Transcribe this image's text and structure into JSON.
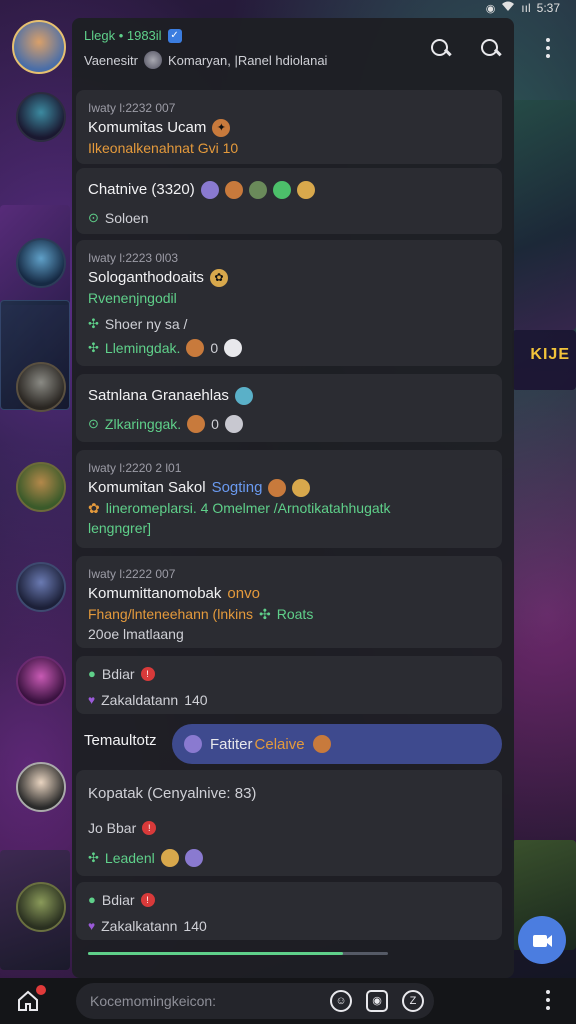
{
  "status_bar": {
    "time": "5:37",
    "signal": "ııl",
    "wifi": "wifi",
    "icon": "◉"
  },
  "header": {
    "title": "Llegk • 1983il",
    "subtitle_prefix": "Vaenesitr",
    "subtitle": "Komaryan, |Ranel hdiolanai"
  },
  "messages": [
    {
      "meta": "Iwaty l:2232 007",
      "title": "Komumitas Ucam",
      "sub": "Ilkeonalkenahnat Gvi 10"
    },
    {
      "title": "Chatnive (3320)",
      "status": "Soloen"
    },
    {
      "meta": "Iwaty l:2223 0l03",
      "title": "Sologanthodoaits",
      "sub": "Rvenenjngodil",
      "line3": "Shoer ny sa /",
      "line4": "Llemingdak.",
      "count": "0"
    },
    {
      "title": "Satnlana Granaehlas",
      "line2": "Zlkaringgak.",
      "count": "0"
    },
    {
      "meta": "Iwaty l:2220 2 l01",
      "title": "Komumitan Sakol",
      "title_accent": "Sogting",
      "sub": "lineromeplarsi. 4 Omelmer /Arnotikatahhugatk",
      "line3": "lengngrer]"
    },
    {
      "meta": "Iwaty l:2222 007",
      "title": "Komumittanomobak",
      "title_accent": "onvo",
      "sub": "Fhang/lnteneehann (lnkins",
      "sub_accent": "Roats",
      "line3": "20oe lmatlaang"
    },
    {
      "line1": "Bdiar",
      "line2": "Zakaldatann",
      "count": "140"
    },
    {
      "label": "Temaultotz",
      "pill": "Fatiter",
      "pill_accent": "Celaive"
    },
    {
      "title": "Kopatak (Cenyalnive: 83)",
      "line2": "Jo Bbar",
      "line3": "Leadenl"
    },
    {
      "line1": "Bdiar",
      "line2": "Zakalkatann",
      "count": "140"
    }
  ],
  "progress": 0.85,
  "composer": {
    "placeholder": "Kocemomingkeicon:"
  },
  "background": {
    "game_label": "KIJE"
  },
  "colors": {
    "accent": "#5fd08a",
    "pill": "#3e4a8e",
    "fab": "#4b7de0",
    "orange": "#e49a3c"
  }
}
